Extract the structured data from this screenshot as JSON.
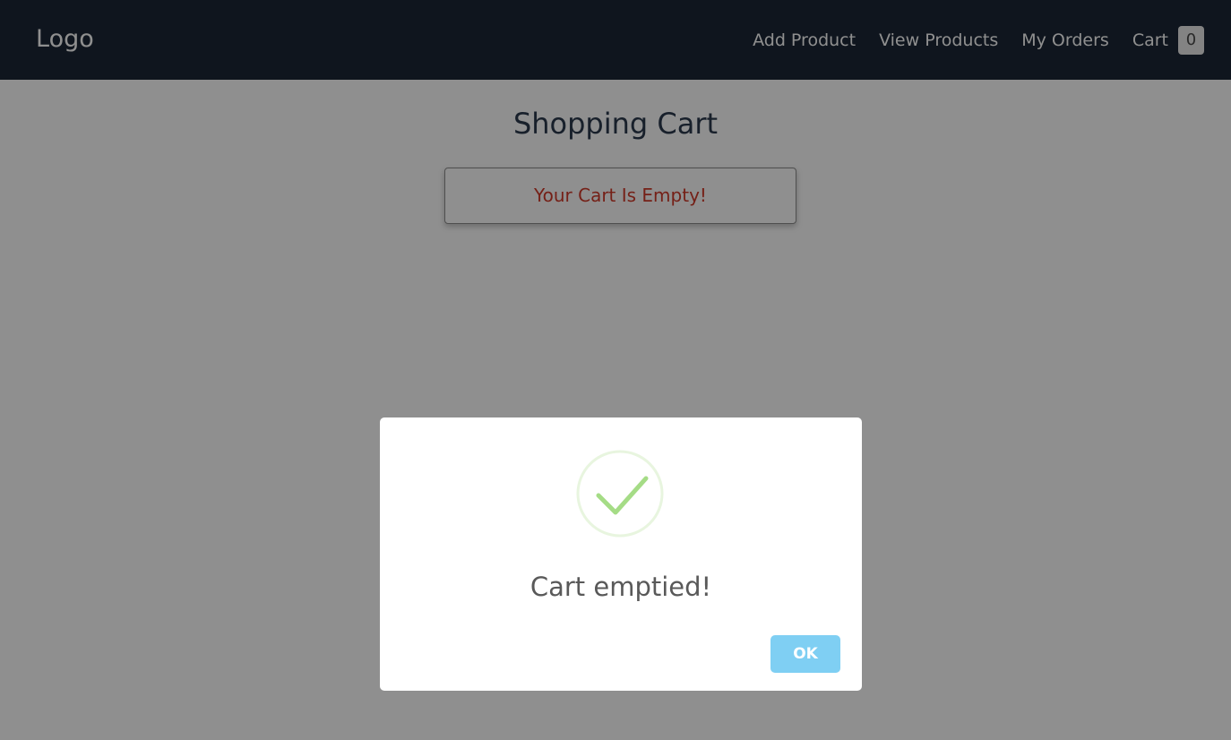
{
  "navbar": {
    "logo": "Logo",
    "links": [
      {
        "label": "Add Product"
      },
      {
        "label": "View Products"
      },
      {
        "label": "My Orders"
      }
    ],
    "cart": {
      "label": "Cart",
      "count": "0"
    }
  },
  "main": {
    "title": "Shopping Cart",
    "empty_message": "Your Cart Is Empty!"
  },
  "modal": {
    "icon": "checkmark-icon",
    "title": "Cart emptied!",
    "ok_label": "OK"
  },
  "colors": {
    "navbar_bg": "#1b2736",
    "empty_text": "#d03a2a",
    "success_green": "#a5dc86",
    "ok_button": "#7fcff3"
  }
}
